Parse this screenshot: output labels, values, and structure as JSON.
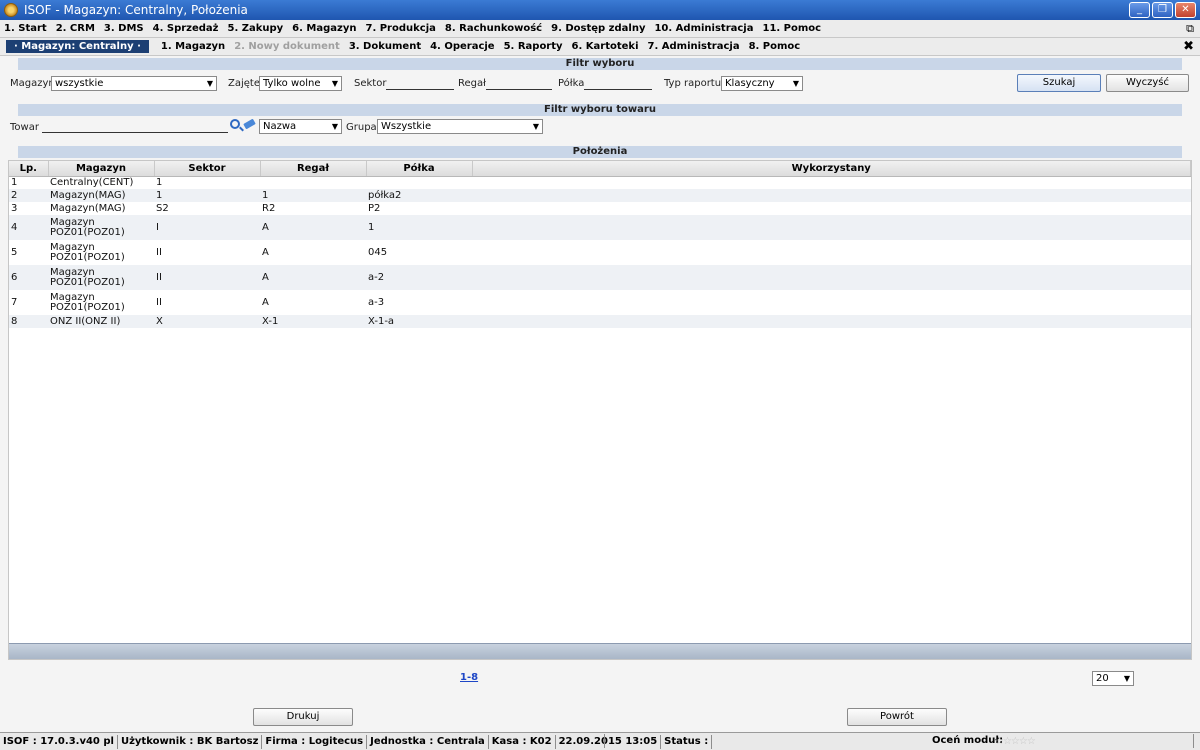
{
  "window": {
    "title": "ISOF - Magazyn: Centralny, Położenia",
    "minimize": "_",
    "restore": "❐",
    "close": "✕"
  },
  "main_menu": [
    "1. Start",
    "2. CRM",
    "3. DMS",
    "4. Sprzedaż",
    "5. Zakupy",
    "6. Magazyn",
    "7. Produkcja",
    "8. Rachunkowość",
    "9. Dostęp zdalny",
    "10. Administracja",
    "11. Pomoc"
  ],
  "sub_menu": {
    "module": "· Magazyn: Centralny ·",
    "items": [
      {
        "label": "1. Magazyn",
        "enabled": true
      },
      {
        "label": "2. Nowy dokument",
        "enabled": false
      },
      {
        "label": "3. Dokument",
        "enabled": true
      },
      {
        "label": "4. Operacje",
        "enabled": true
      },
      {
        "label": "5. Raporty",
        "enabled": true
      },
      {
        "label": "6. Kartoteki",
        "enabled": true
      },
      {
        "label": "7. Administracja",
        "enabled": true
      },
      {
        "label": "8. Pomoc",
        "enabled": true
      }
    ],
    "close": "✖"
  },
  "filter": {
    "header": "Filtr wyboru",
    "magazyn_label": "Magazyn",
    "magazyn_value": "wszystkie",
    "zajete_label": "Zajęte",
    "zajete_value": "Tylko wolne",
    "sektor_label": "Sektor",
    "regal_label": "Regał",
    "polka_label": "Półka",
    "typ_label": "Typ raportu",
    "typ_value": "Klasyczny",
    "search_button": "Szukaj",
    "clear_button": "Wyczyść"
  },
  "product_filter": {
    "header": "Filtr wyboru towaru",
    "towar_label": "Towar",
    "field_value": "Nazwa",
    "grupa_label": "Grupa",
    "grupa_value": "Wszystkie"
  },
  "locations": {
    "header": "Położenia",
    "columns": [
      "Lp.",
      "Magazyn",
      "Sektor",
      "Regał",
      "Półka",
      "Wykorzystany"
    ],
    "rows": [
      [
        "1",
        "Centralny(CENT)",
        "1",
        "",
        "",
        ""
      ],
      [
        "2",
        "Magazyn(MAG)",
        "1",
        "1",
        "półka2",
        ""
      ],
      [
        "3",
        "Magazyn(MAG)",
        "S2",
        "R2",
        "P2",
        ""
      ],
      [
        "4",
        "Magazyn POZ01(POZ01)",
        "I",
        "A",
        "1",
        ""
      ],
      [
        "5",
        "Magazyn POZ01(POZ01)",
        "II",
        "A",
        "045",
        ""
      ],
      [
        "6",
        "Magazyn POZ01(POZ01)",
        "II",
        "A",
        "a-2",
        ""
      ],
      [
        "7",
        "Magazyn POZ01(POZ01)",
        "II",
        "A",
        "a-3",
        ""
      ],
      [
        "8",
        "ONZ II(ONZ II)",
        "X",
        "X-1",
        "X-1-a",
        ""
      ]
    ],
    "pager": "1-8",
    "page_size": "20"
  },
  "actions": {
    "print_button": "Drukuj",
    "back_button": "Powrót"
  },
  "status_bar": {
    "version": "ISOF : 17.0.3.v40 pl",
    "user": "Użytkownik : BK Bartosz",
    "company": "Firma : Logitecus",
    "unit": "Jednostka : Centrala",
    "cash": "Kasa : K02",
    "datetime": "22.09.2015 13:05",
    "status": "Status :",
    "rate_label": "Oceń moduł:",
    "stars": "☆☆☆☆☆"
  }
}
